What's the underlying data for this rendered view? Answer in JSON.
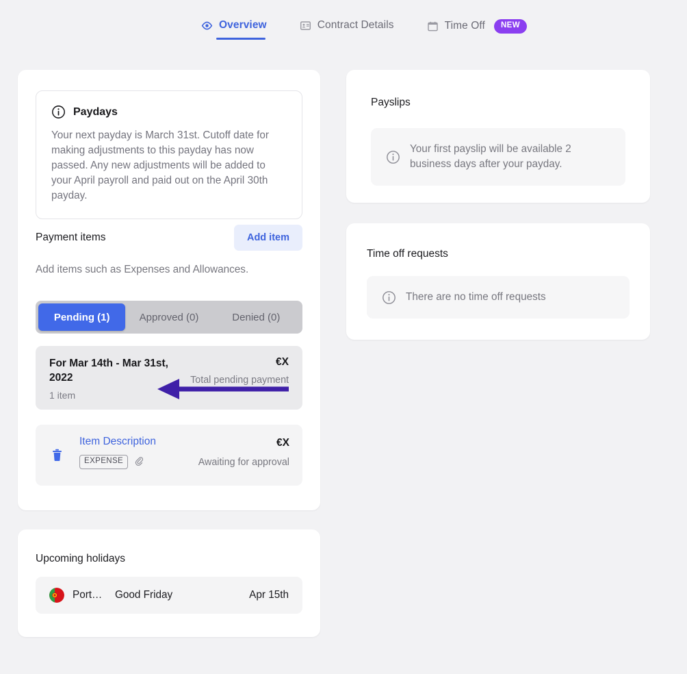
{
  "theme": {
    "page_background": "#f2f2f4",
    "card_background": "#ffffff",
    "accent_blue": "#3e63dd",
    "active_tab_blue": "#4169e8",
    "badge_purple": "#8b3ff0",
    "annotation_purple": "#3f20a8",
    "muted_text": "#77777f"
  },
  "tabbar": {
    "tabs": [
      {
        "label": "Overview",
        "icon": "eye-icon",
        "active": true
      },
      {
        "label": "Contract Details",
        "icon": "id-card-icon",
        "active": false
      },
      {
        "label": "Time Off",
        "icon": "calendar-icon",
        "active": false,
        "badge": "NEW"
      }
    ]
  },
  "payments_card": {
    "notice": {
      "icon": "info-circle-icon",
      "title": "Paydays",
      "body": "Your next payday is March 31st. Cutoff date for making adjustments to this payday has now passed. Any new adjustments will be added to your April payroll and paid out on the April 30th payday."
    },
    "section_title": "Payment items",
    "add_item_label": "Add item",
    "subtitle": "Add items such as Expenses and Allowances.",
    "segmented_tabs": [
      {
        "label": "Pending (1)",
        "active": true
      },
      {
        "label": "Approved (0)",
        "active": false
      },
      {
        "label": "Denied (0)",
        "active": false
      }
    ],
    "group": {
      "title": "For Mar 14th - Mar 31st, 2022",
      "count": "1 item",
      "amount": "€X",
      "amount_label": "Total pending payment"
    },
    "items": [
      {
        "delete_icon": "trash-icon",
        "description": "Item Description",
        "tag": "EXPENSE",
        "attachment_icon": "paperclip-icon",
        "amount": "€X",
        "status": "Awaiting for approval"
      }
    ]
  },
  "payslips_card": {
    "title": "Payslips",
    "info": {
      "icon": "info-circle-icon",
      "text": "Your first payslip will be available 2 business days after your payday."
    }
  },
  "timeoff_card": {
    "title": "Time off requests",
    "info": {
      "icon": "info-circle-icon",
      "text": "There are no time off requests"
    }
  },
  "holidays_card": {
    "title": "Upcoming holidays",
    "rows": [
      {
        "flag": "portugal-flag-icon",
        "country": "Port…",
        "name": "Good Friday",
        "date": "Apr 15th"
      }
    ]
  },
  "annotation": {
    "type": "arrow",
    "direction": "left",
    "points_to": "Pending (1)"
  }
}
